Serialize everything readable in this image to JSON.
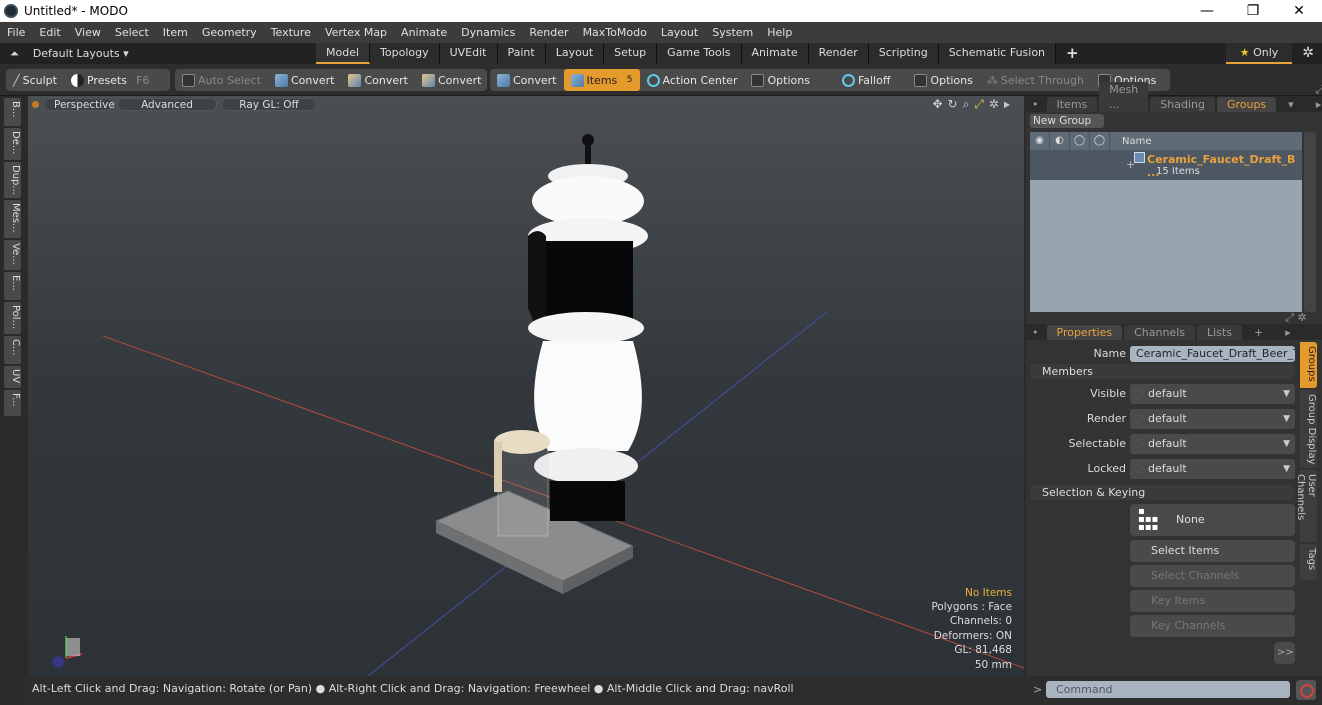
{
  "window": {
    "title": "Untitled* - MODO",
    "controls": {
      "minimize": "—",
      "maximize": "❐",
      "close": "✕"
    }
  },
  "menu": [
    "File",
    "Edit",
    "View",
    "Select",
    "Item",
    "Geometry",
    "Texture",
    "Vertex Map",
    "Animate",
    "Dynamics",
    "Render",
    "MaxToModo",
    "Layout",
    "System",
    "Help"
  ],
  "layoutbar": {
    "default_layouts": "Default Layouts ▾",
    "tabs": [
      "Model",
      "Topology",
      "UVEdit",
      "Paint",
      "Layout",
      "Setup",
      "Game Tools",
      "Animate",
      "Render",
      "Scripting",
      "Schematic Fusion"
    ],
    "active_tab": "Model",
    "add_tab": "+",
    "only_label": "Only",
    "star": "★"
  },
  "toolbar": {
    "sculpt": "Sculpt",
    "presets": "Presets",
    "presets_key": "F6",
    "auto_select": "Auto Select",
    "convert1": "Convert",
    "convert2": "Convert",
    "convert3": "Convert",
    "convert4": "Convert",
    "items": "Items",
    "items_key": "5",
    "action_center": "Action Center",
    "options1": "Options",
    "falloff": "Falloff",
    "options2": "Options",
    "select_through": "Select Through",
    "options3": "Options"
  },
  "left_tabs": [
    "B...",
    "De...",
    "Dup...",
    "Mes...",
    "Ve...",
    "E...",
    "Pol...",
    "C...",
    "UV",
    "F..."
  ],
  "viewport": {
    "view_mode": "Perspective",
    "shading": "Advanced",
    "raygl": "Ray GL: Off",
    "stats": {
      "selection": "No Items",
      "polygons": "Polygons : Face",
      "channels": "Channels: 0",
      "deformers": "Deformers: ON",
      "gl": "GL: 81,468",
      "scale": "50 mm"
    }
  },
  "statusbar": "Alt-Left Click and Drag: Navigation: Rotate (or Pan) ● Alt-Right Click and Drag: Navigation: Freewheel ● Alt-Middle Click and Drag: navRoll",
  "groups_panel": {
    "tabs": [
      "Items",
      "Mesh ...",
      "Shading",
      "Groups"
    ],
    "active_tab": "Groups",
    "new_group": "New Group",
    "name_header": "Name",
    "group": {
      "name": "Ceramic_Faucet_Draft_B ...",
      "count": "15 Items",
      "expand": "+"
    }
  },
  "properties_panel": {
    "tabs": [
      "Properties",
      "Channels",
      "Lists"
    ],
    "active_tab": "Properties",
    "add_tab": "+",
    "name_label": "Name",
    "name_value": "Ceramic_Faucet_Draft_Beer_Tow",
    "members_section": "Members",
    "fields": [
      {
        "label": "Visible",
        "value": "default"
      },
      {
        "label": "Render",
        "value": "default"
      },
      {
        "label": "Selectable",
        "value": "default"
      },
      {
        "label": "Locked",
        "value": "default"
      }
    ],
    "selection_section": "Selection & Keying",
    "none_button": "None",
    "select_items": "Select Items",
    "select_channels": "Select Channels",
    "key_items": "Key Items",
    "key_channels": "Key Channels",
    "more": ">>",
    "side_tabs": [
      "Groups",
      "Group Display",
      "User Channels",
      "Tags"
    ]
  },
  "command": {
    "prompt": ">",
    "placeholder": "Command"
  }
}
